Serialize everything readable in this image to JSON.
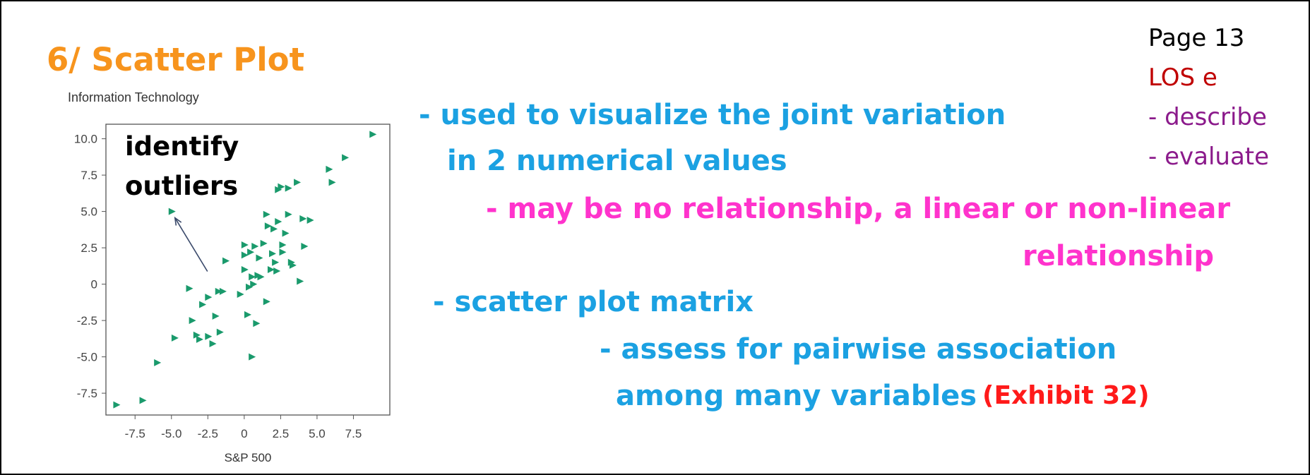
{
  "slide": {
    "title": "6/ Scatter Plot",
    "page": "Page 13",
    "los": "LOS e",
    "verbs": [
      "- describe",
      "- evaluate"
    ],
    "annotation": [
      "identify",
      "outliers"
    ],
    "bullets": [
      "- used to visualize the joint variation",
      "in 2 numerical values",
      "- may be no relationship, a linear or non-linear",
      "relationship",
      "- scatter plot matrix",
      "- assess for pairwise association",
      "among many variables",
      "(Exhibit 32)"
    ]
  },
  "colors": {
    "title": "#f7941d",
    "bullet_blue": "#1ba1e2",
    "bullet_pink": "#ff33cc",
    "exhibit_red": "#ff1a1a",
    "marker": "#1a9a6c"
  },
  "chart_data": {
    "type": "scatter",
    "title": "Information Technology",
    "xlabel": "S&P 500",
    "ylabel": "",
    "xlim": [
      -9.5,
      10
    ],
    "ylim": [
      -9,
      11
    ],
    "xticks": [
      "-7.5",
      "-5.0",
      "-2.5",
      "0",
      "2.5",
      "5.0",
      "7.5"
    ],
    "xtick_values": [
      -7.5,
      -5.0,
      -2.5,
      0,
      2.5,
      5.0,
      7.5
    ],
    "yticks": [
      "10.0",
      "7.5",
      "5.0",
      "2.5",
      "0",
      "-2.5",
      "-5.0",
      "-7.5"
    ],
    "ytick_values": [
      10.0,
      7.5,
      5.0,
      2.5,
      0,
      -2.5,
      -5.0,
      -7.5
    ],
    "marker": "triangle-right",
    "x": [
      -8.8,
      -7.0,
      -6.0,
      -5.0,
      -4.8,
      -3.8,
      -3.6,
      -3.3,
      -3.1,
      -2.9,
      -2.5,
      -2.5,
      -2.2,
      -2.0,
      -1.8,
      -1.7,
      -1.5,
      -1.3,
      -0.3,
      0.0,
      0.0,
      0.0,
      0.2,
      0.3,
      0.4,
      0.5,
      0.5,
      0.6,
      0.7,
      0.8,
      0.9,
      1.0,
      1.1,
      1.3,
      1.5,
      1.5,
      1.6,
      1.8,
      1.9,
      2.0,
      2.1,
      2.2,
      2.3,
      2.3,
      2.5,
      2.6,
      2.6,
      2.8,
      3.0,
      3.0,
      3.2,
      3.3,
      3.6,
      3.8,
      4.0,
      4.1,
      4.5,
      5.8,
      6.0,
      6.9,
      8.8
    ],
    "y": [
      -8.3,
      -8.0,
      -5.4,
      5.0,
      -3.7,
      -0.3,
      -2.5,
      -3.5,
      -3.8,
      -1.4,
      -3.6,
      -0.9,
      -4.1,
      -2.2,
      -0.5,
      -3.3,
      -0.5,
      1.6,
      -0.7,
      1.0,
      2.0,
      2.7,
      -2.1,
      -0.2,
      2.2,
      -5.0,
      0.5,
      0.0,
      2.6,
      -2.7,
      0.6,
      1.8,
      0.5,
      2.8,
      -1.2,
      4.8,
      4.0,
      1.0,
      2.1,
      3.8,
      1.5,
      0.9,
      6.5,
      4.3,
      6.7,
      2.2,
      2.7,
      3.5,
      4.8,
      6.6,
      1.5,
      1.3,
      7.0,
      0.2,
      4.5,
      2.6,
      4.4,
      7.9,
      7.0,
      8.7,
      10.3
    ],
    "outlier": {
      "x": -5.0,
      "y": 5.0
    },
    "grid": false,
    "legend": "none"
  }
}
